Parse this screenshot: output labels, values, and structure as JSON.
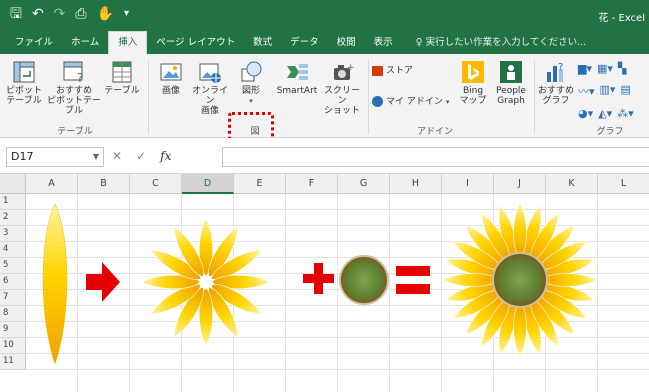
{
  "window": {
    "title": "花 - Excel",
    "qat_icons": [
      "save-icon",
      "undo-icon",
      "redo-icon",
      "print-preview-icon",
      "touch-mode-icon",
      "customize-qat-icon"
    ]
  },
  "tabs": [
    {
      "label": "ファイル",
      "active": false
    },
    {
      "label": "ホーム",
      "active": false
    },
    {
      "label": "挿入",
      "active": true
    },
    {
      "label": "ページ レイアウト",
      "active": false
    },
    {
      "label": "数式",
      "active": false
    },
    {
      "label": "データ",
      "active": false
    },
    {
      "label": "校閲",
      "active": false
    },
    {
      "label": "表示",
      "active": false
    }
  ],
  "tell_me": "♀ 実行したい作業を入力してください...",
  "ribbon": {
    "pivot_table": "ピボット\nテーブル",
    "recommended_pivot": "おすすめ\nピボットテーブル",
    "table": "テーブル",
    "group_table": "テーブル",
    "picture": "画像",
    "online_picture": "オンライン\n画像",
    "shapes": "図形",
    "smartart": "SmartArt",
    "screenshot": "スクリーン\nショット",
    "group_illustrations": "図",
    "store": "ストア",
    "my_addins": "マイ アドイン",
    "bing_maps": "Bing\nマップ",
    "people_graph": "People\nGraph",
    "group_addins": "アドイン",
    "recommended_charts": "おすすめ\nグラフ",
    "group_charts": "グラフ"
  },
  "formula_bar": {
    "name_box": "D17",
    "cancel": "✕",
    "enter": "✓",
    "fx": "fx",
    "formula": ""
  },
  "sheet": {
    "columns": [
      "A",
      "B",
      "C",
      "D",
      "E",
      "F",
      "G",
      "H",
      "I",
      "J",
      "K",
      "L"
    ],
    "selected_column": "D",
    "rows": [
      "1",
      "2",
      "3",
      "4",
      "5",
      "6",
      "7",
      "8",
      "9",
      "10",
      "11"
    ]
  },
  "colors": {
    "excel_green": "#217346",
    "ribbon_bg": "#f3f3f3",
    "highlight_red": "#e00000",
    "petal_yellow": "#ffd400",
    "petal_orange": "#f0a000",
    "center_green": "#6e8f3a",
    "center_brown": "#7a5a20",
    "operator_red": "#e60000"
  }
}
